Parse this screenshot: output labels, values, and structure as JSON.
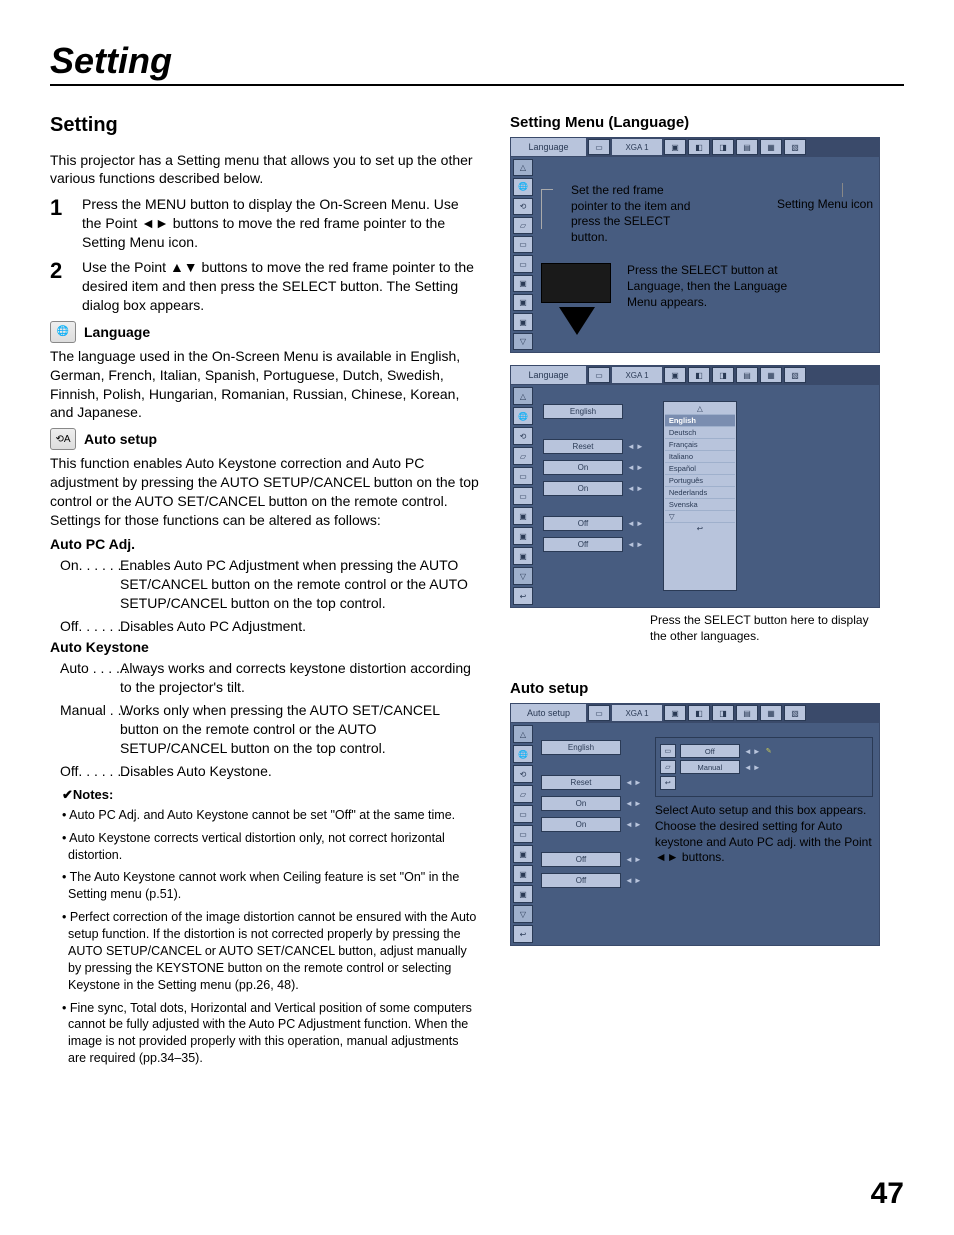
{
  "chapterTitle": "Setting",
  "sectionTitle": "Setting",
  "intro": "This projector has a Setting menu that allows you to set up the other various functions described below.",
  "step1": "Press the MENU button to display the On-Screen Menu. Use the Point ◄► buttons to move the red frame pointer to the Setting Menu icon.",
  "step2": "Use the Point ▲▼ buttons to move the red frame pointer to the desired item and then press the SELECT button. The Setting dialog box appears.",
  "langHead": "Language",
  "langPara": "The language used in the On-Screen Menu is available in English, German, French, Italian, Spanish, Portuguese, Dutch, Swedish, Finnish, Polish, Hungarian, Romanian, Russian, Chinese, Korean, and Japanese.",
  "autoHead": "Auto setup",
  "autoPara": "This function enables Auto Keystone correction and Auto PC adjustment by pressing the AUTO SETUP/CANCEL button on the top control or the AUTO SET/CANCEL button on the remote control. Settings for those functions can be altered as follows:",
  "pcHead": "Auto PC Adj.",
  "pcOn": "Enables Auto PC Adjustment when pressing the AUTO SET/CANCEL button on the remote control or the AUTO SETUP/CANCEL button on the top control.",
  "pcOff": "Disables Auto PC Adjustment.",
  "ksHead": "Auto Keystone",
  "ksAuto": "Always works and corrects keystone distortion according to the projector's tilt.",
  "ksManual": "Works only when pressing the AUTO SET/CANCEL button on the remote control or the AUTO SETUP/CANCEL button on the top control.",
  "ksOff": "Disables Auto Keystone.",
  "notesHead": "✔Notes:",
  "note1": "Auto PC Adj. and Auto Keystone cannot be set \"Off\" at the same time.",
  "note2": "Auto Keystone corrects vertical distortion only, not correct horizontal distortion.",
  "note3": "The Auto Keystone cannot work when Ceiling feature is set \"On\" in the Setting menu (p.51).",
  "note4": "Perfect correction of the image distortion cannot be ensured with the Auto setup function. If the distortion is not corrected properly by pressing the AUTO SETUP/CANCEL or AUTO SET/CANCEL button, adjust manually by pressing the KEYSTONE button on the remote control or selecting Keystone in the Setting menu (pp.26, 48).",
  "note5": "Fine sync, Total dots, Horizontal and Vertical position of some computers cannot be fully adjusted with the Auto PC Adjustment function. When the image is not provided properly with this operation, manual adjustments are required (pp.34–35).",
  "rightHead1": "Setting Menu (Language)",
  "mbLabelLang": "Language",
  "mbLabelAuto": "Auto setup",
  "mbSignal": "XGA 1",
  "callout1a": "Set the red frame pointer to the item and press the SELECT button.",
  "callout1b": "Setting Menu icon",
  "callout2": "Press the SELECT button at Language, then the Language Menu appears.",
  "optEnglish": "English",
  "optReset": "Reset",
  "optOn": "On",
  "optOff": "Off",
  "optManual": "Manual",
  "langs": {
    "l0": "English",
    "l1": "Deutsch",
    "l2": "Français",
    "l3": "Italiano",
    "l4": "Español",
    "l5": "Português",
    "l6": "Nederlands",
    "l7": "Svenska"
  },
  "caption3": "Press the SELECT button here to display the other languages.",
  "rightHead2": "Auto setup",
  "caption4": "Select Auto setup and this box appears. Choose the desired setting for Auto keystone and Auto PC adj. with the Point ◄► buttons.",
  "pageNum": "47",
  "terms": {
    "on": "On. . . . . . .",
    "off": "Off. . . . . . .",
    "auto": "Auto . . . . .",
    "manual": "Manual . . ."
  }
}
